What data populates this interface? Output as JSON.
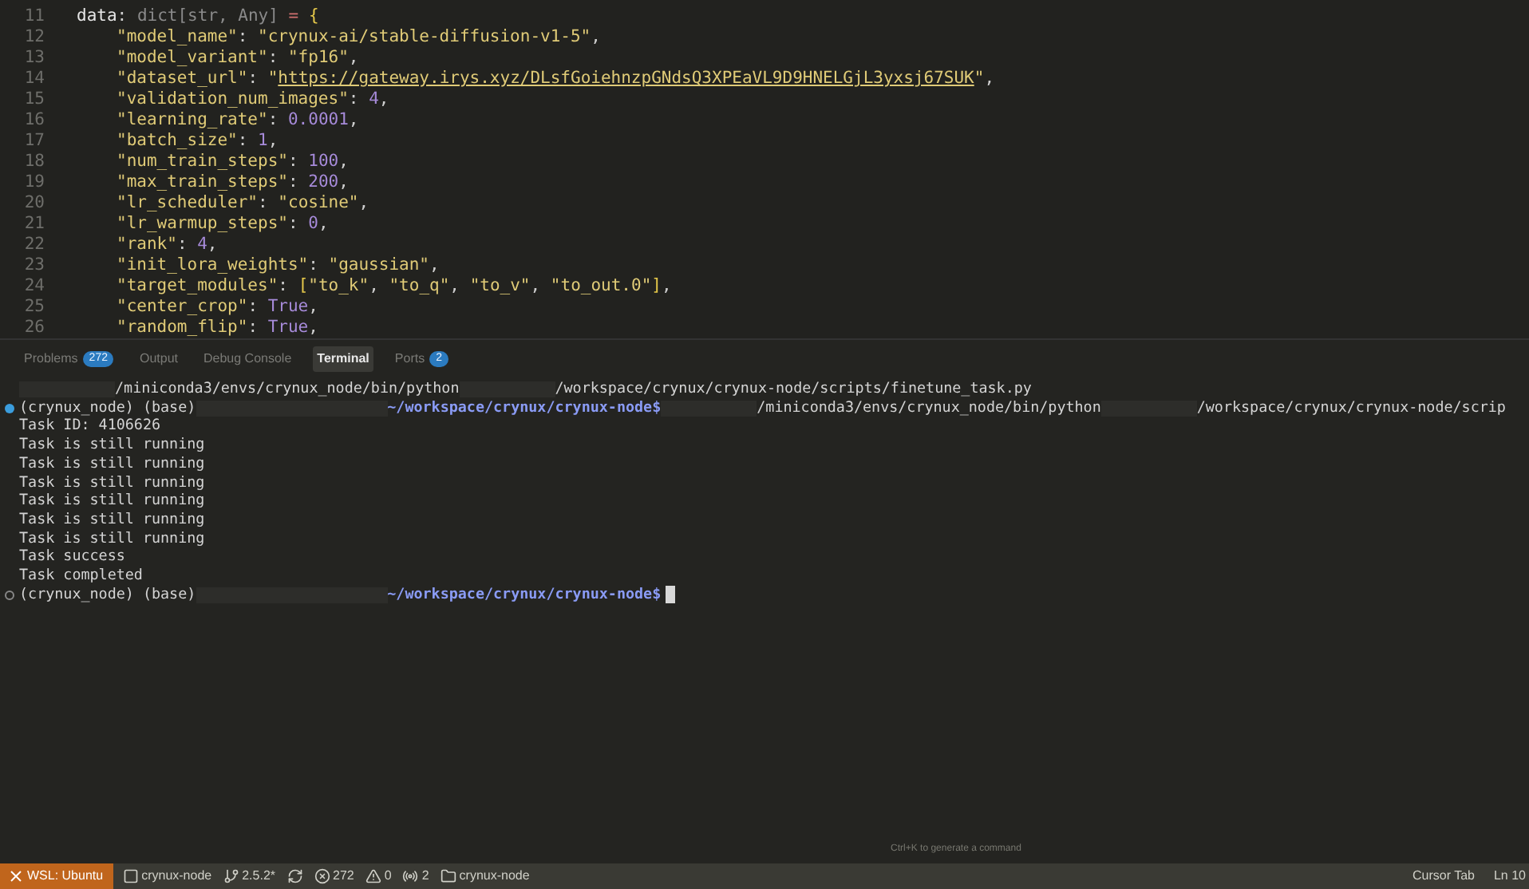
{
  "editor": {
    "lines": [
      {
        "number": "11",
        "tokens": [
          {
            "kind": "var",
            "text": "data"
          },
          {
            "kind": "punct",
            "text": ": "
          },
          {
            "kind": "type",
            "text": "dict[str, Any]"
          },
          {
            "kind": "op",
            "text": " = "
          },
          {
            "kind": "bracket",
            "text": "{"
          }
        ],
        "children": [
          {
            "number": "12",
            "tokens": [
              {
                "kind": "string",
                "text": "\"model_name\""
              },
              {
                "kind": "punct",
                "text": ": "
              },
              {
                "kind": "string",
                "text": "\"crynux-ai/stable-diffusion-v1-5\""
              },
              {
                "kind": "punct",
                "text": ","
              }
            ]
          },
          {
            "number": "13",
            "tokens": [
              {
                "kind": "string",
                "text": "\"model_variant\""
              },
              {
                "kind": "punct",
                "text": ": "
              },
              {
                "kind": "string",
                "text": "\"fp16\""
              },
              {
                "kind": "punct",
                "text": ","
              }
            ]
          },
          {
            "number": "14",
            "tokens": [
              {
                "kind": "string",
                "text": "\"dataset_url\""
              },
              {
                "kind": "punct",
                "text": ": "
              },
              {
                "kind": "string",
                "text": "\""
              },
              {
                "kind": "url",
                "text": "https://gateway.irys.xyz/DLsfGoiehnzpGNdsQ3XPEaVL9D9HNELGjL3yxsj67SUK"
              },
              {
                "kind": "string",
                "text": "\""
              },
              {
                "kind": "punct",
                "text": ","
              }
            ]
          },
          {
            "number": "15",
            "tokens": [
              {
                "kind": "string",
                "text": "\"validation_num_images\""
              },
              {
                "kind": "punct",
                "text": ": "
              },
              {
                "kind": "number",
                "text": "4"
              },
              {
                "kind": "punct",
                "text": ","
              }
            ]
          },
          {
            "number": "16",
            "tokens": [
              {
                "kind": "string",
                "text": "\"learning_rate\""
              },
              {
                "kind": "punct",
                "text": ": "
              },
              {
                "kind": "number",
                "text": "0.0001"
              },
              {
                "kind": "punct",
                "text": ","
              }
            ]
          },
          {
            "number": "17",
            "tokens": [
              {
                "kind": "string",
                "text": "\"batch_size\""
              },
              {
                "kind": "punct",
                "text": ": "
              },
              {
                "kind": "number",
                "text": "1"
              },
              {
                "kind": "punct",
                "text": ","
              }
            ]
          },
          {
            "number": "18",
            "tokens": [
              {
                "kind": "string",
                "text": "\"num_train_steps\""
              },
              {
                "kind": "punct",
                "text": ": "
              },
              {
                "kind": "number",
                "text": "100"
              },
              {
                "kind": "punct",
                "text": ","
              }
            ]
          },
          {
            "number": "19",
            "tokens": [
              {
                "kind": "string",
                "text": "\"max_train_steps\""
              },
              {
                "kind": "punct",
                "text": ": "
              },
              {
                "kind": "number",
                "text": "200"
              },
              {
                "kind": "punct",
                "text": ","
              }
            ]
          },
          {
            "number": "20",
            "tokens": [
              {
                "kind": "string",
                "text": "\"lr_scheduler\""
              },
              {
                "kind": "punct",
                "text": ": "
              },
              {
                "kind": "string",
                "text": "\"cosine\""
              },
              {
                "kind": "punct",
                "text": ","
              }
            ]
          },
          {
            "number": "21",
            "tokens": [
              {
                "kind": "string",
                "text": "\"lr_warmup_steps\""
              },
              {
                "kind": "punct",
                "text": ": "
              },
              {
                "kind": "number",
                "text": "0"
              },
              {
                "kind": "punct",
                "text": ","
              }
            ]
          },
          {
            "number": "22",
            "tokens": [
              {
                "kind": "string",
                "text": "\"rank\""
              },
              {
                "kind": "punct",
                "text": ": "
              },
              {
                "kind": "number",
                "text": "4"
              },
              {
                "kind": "punct",
                "text": ","
              }
            ]
          },
          {
            "number": "23",
            "tokens": [
              {
                "kind": "string",
                "text": "\"init_lora_weights\""
              },
              {
                "kind": "punct",
                "text": ": "
              },
              {
                "kind": "string",
                "text": "\"gaussian\""
              },
              {
                "kind": "punct",
                "text": ","
              }
            ]
          },
          {
            "number": "24",
            "tokens": [
              {
                "kind": "string",
                "text": "\"target_modules\""
              },
              {
                "kind": "punct",
                "text": ": "
              },
              {
                "kind": "bracket",
                "text": "["
              },
              {
                "kind": "string",
                "text": "\"to_k\""
              },
              {
                "kind": "punct",
                "text": ", "
              },
              {
                "kind": "string",
                "text": "\"to_q\""
              },
              {
                "kind": "punct",
                "text": ", "
              },
              {
                "kind": "string",
                "text": "\"to_v\""
              },
              {
                "kind": "punct",
                "text": ", "
              },
              {
                "kind": "string",
                "text": "\"to_out.0\""
              },
              {
                "kind": "bracket",
                "text": "]"
              },
              {
                "kind": "punct",
                "text": ","
              }
            ]
          },
          {
            "number": "25",
            "tokens": [
              {
                "kind": "string",
                "text": "\"center_crop\""
              },
              {
                "kind": "punct",
                "text": ": "
              },
              {
                "kind": "keyword",
                "text": "True"
              },
              {
                "kind": "punct",
                "text": ","
              }
            ]
          },
          {
            "number": "26",
            "tokens": [
              {
                "kind": "string",
                "text": "\"random_flip\""
              },
              {
                "kind": "punct",
                "text": ": "
              },
              {
                "kind": "keyword",
                "text": "True"
              },
              {
                "kind": "punct",
                "text": ","
              }
            ]
          }
        ]
      }
    ]
  },
  "panel_tabs": [
    {
      "label": "Problems",
      "selected": false,
      "badge": "272"
    },
    {
      "label": "Output",
      "selected": false
    },
    {
      "label": "Debug Console",
      "selected": false
    },
    {
      "label": "Terminal",
      "selected": true
    },
    {
      "label": "Ports",
      "selected": false,
      "badge": "2"
    }
  ],
  "terminal": {
    "lines": [
      {
        "kind": "output",
        "segments": [
          {
            "kind": "redacted"
          },
          {
            "kind": "text",
            "text": "/miniconda3/envs/crynux_node/bin/python"
          },
          {
            "kind": "redacted"
          },
          {
            "kind": "text",
            "text": "/workspace/crynux/crynux-node/scripts/finetune_task.py"
          }
        ]
      },
      {
        "kind": "prompt",
        "completed": true,
        "segments": [
          {
            "kind": "text",
            "text": "(crynux_node) (base)"
          },
          {
            "kind": "redacted_long"
          },
          {
            "kind": "path",
            "text": "~/workspace/crynux/crynux-node$"
          },
          {
            "kind": "redacted"
          },
          {
            "kind": "text",
            "text": "/miniconda3/envs/crynux_node/bin/python"
          },
          {
            "kind": "redacted"
          },
          {
            "kind": "text",
            "text": "/workspace/crynux/crynux-node/scrip"
          }
        ]
      },
      {
        "kind": "output",
        "segments": [
          {
            "kind": "text",
            "text": "Task ID: 4106626"
          }
        ]
      },
      {
        "kind": "output",
        "segments": [
          {
            "kind": "text",
            "text": "Task is still running"
          }
        ]
      },
      {
        "kind": "output",
        "segments": [
          {
            "kind": "text",
            "text": "Task is still running"
          }
        ]
      },
      {
        "kind": "output",
        "segments": [
          {
            "kind": "text",
            "text": "Task is still running"
          }
        ]
      },
      {
        "kind": "output",
        "segments": [
          {
            "kind": "text",
            "text": "Task is still running"
          }
        ]
      },
      {
        "kind": "output",
        "segments": [
          {
            "kind": "text",
            "text": "Task is still running"
          }
        ]
      },
      {
        "kind": "output",
        "segments": [
          {
            "kind": "text",
            "text": "Task is still running"
          }
        ]
      },
      {
        "kind": "output",
        "segments": [
          {
            "kind": "text",
            "text": "Task success"
          }
        ]
      },
      {
        "kind": "output",
        "segments": [
          {
            "kind": "text",
            "text": "Task completed"
          }
        ]
      },
      {
        "kind": "prompt",
        "completed": false,
        "segments": [
          {
            "kind": "text",
            "text": "(crynux_node) (base)"
          },
          {
            "kind": "redacted_long"
          },
          {
            "kind": "path",
            "text": "~/workspace/crynux/crynux-node$"
          },
          {
            "kind": "cursor"
          }
        ]
      }
    ],
    "hint": "Ctrl+K to generate a command"
  },
  "status_bar": {
    "remote": "WSL: Ubuntu",
    "left": [
      {
        "kind": "project",
        "text": "crynux-node"
      },
      {
        "kind": "branch",
        "text": "2.5.2*"
      },
      {
        "kind": "sync"
      },
      {
        "kind": "errors",
        "text": "272"
      },
      {
        "kind": "warnings",
        "text": "0"
      },
      {
        "kind": "ports",
        "text": "2"
      },
      {
        "kind": "folder",
        "text": "crynux-node"
      }
    ],
    "right": [
      {
        "kind": "text",
        "text": "Cursor Tab"
      },
      {
        "kind": "text",
        "text": "Ln 10"
      }
    ]
  }
}
